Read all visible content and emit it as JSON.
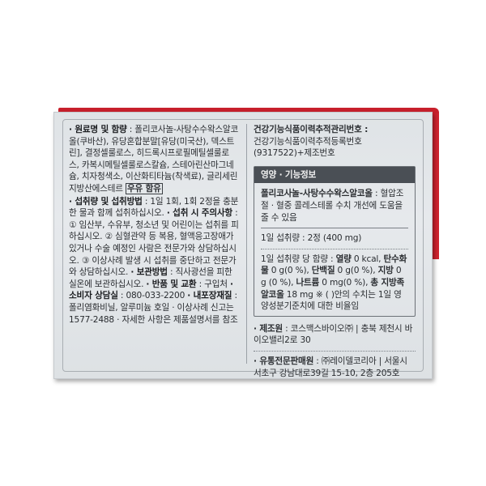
{
  "left": {
    "p1_label": "· 원료명 및 함량",
    "p1_text": " : 폴리코사놀-사탕수수왁스알코올(쿠바산), 유당혼합분말[유당(미국산), 덱스트린], 결정셀룰로스, 히드록시프로필메틸셀룰로스, 카복시메틸셀룰로스칼슘, 스테아린산마그네슘, 치자청색소, 이산화티타늄(착색료), 글리세린지방산에스테르 ",
    "allergy": "우유 함유",
    "p2_label": "· 섭취량 및 섭취방법",
    "p2_text": " : 1일 1회, 1회 2정을 충분한 물과 함께 섭취하십시오. ",
    "p3_label": "· 섭취 시 주의사항",
    "p3_text": " : ① 임산부, 수유부, 청소년 및 어린이는 섭취를 피하십시오. ② 심혈관약 등 복용, 혈액응고장애가 있거나 수술 예정인 사람은 전문가와 상담하십시오. ③ 이상사례 발생 시 섭취를 중단하고 전문가와 상담하십시오. ",
    "p4_label": "· 보관방법",
    "p4_text": " : 직사광선을 피한 실온에 보관하십시오. ",
    "p5_label": "· 반품 및 교환",
    "p5_text": " : 구입처 ",
    "p6_label": "· 소비자 상담실",
    "p6_text": " : 080-033-2200 ",
    "p7_label": "· 내포장재질",
    "p7_text": " : 폴리염화비닐, 알루미늄 호일 · 이상사례 신고는 1577-2488 · 자세한 사항은 제품설명서를 참조"
  },
  "right": {
    "trace_label": "건강기능식품이력추적관리번호 :",
    "trace_text": "건강기능식품이력추적등록번호(9317522)+제조번호",
    "nutri_title": "영양 · 기능정보",
    "func_label": "폴리코사놀-사탕수수왁스알코올",
    "func_text": " : 혈압조절 · 혈중 콜레스테롤 수치 개선에 도움을 줄 수 있음",
    "serving": "1일 섭취량 : 2정 (400 mg)",
    "n_intro": "1일 섭취량 당 함량 : ",
    "n1_l": "열량",
    "n1_v": " 0 kcal, ",
    "n2_l": "탄수화물",
    "n2_v": " 0 g(0 %), ",
    "n3_l": "단백질",
    "n3_v": " 0 g(0 %), ",
    "n4_l": "지방",
    "n4_v": " 0 g (0 %), ",
    "n5_l": "나트륨",
    "n5_v": " 0 mg(0 %), ",
    "n6_l": "총 지방족 알코올",
    "n6_v": " 18 mg ",
    "n_note": "※ ( )안의 수치는 1일 영양성분기준치에 대한 비율임",
    "maker_label": "· 제조원",
    "maker_text": " : 코스맥스바이오㈜ | 충북 제천시 바이오밸리2로 30",
    "dist_label": "· 유통전문판매원",
    "dist_text": " : ㈜레이델코리아 | 서울시 서초구 강남대로39길 15-10, 2층 205호"
  }
}
